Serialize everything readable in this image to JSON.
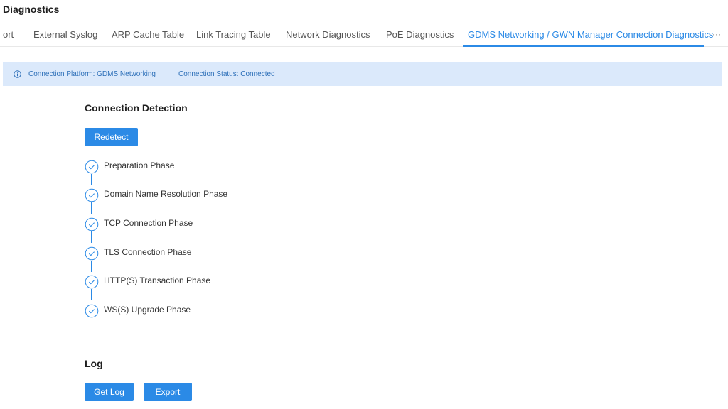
{
  "page": {
    "title": "Diagnostics"
  },
  "tabs": [
    {
      "label": "ort"
    },
    {
      "label": "External Syslog"
    },
    {
      "label": "ARP Cache Table"
    },
    {
      "label": "Link Tracing Table"
    },
    {
      "label": "Network Diagnostics"
    },
    {
      "label": "PoE Diagnostics"
    },
    {
      "label": "GDMS Networking / GWN Manager Connection Diagnostics"
    }
  ],
  "tabs_more": "···",
  "info": {
    "icon": "info-circle-icon",
    "platform": "Connection Platform: GDMS Networking",
    "status": "Connection Status: Connected"
  },
  "detection": {
    "title": "Connection Detection",
    "redetect_label": "Redetect",
    "phases": [
      {
        "label": "Preparation Phase",
        "status": "done"
      },
      {
        "label": "Domain Name Resolution Phase",
        "status": "done"
      },
      {
        "label": "TCP Connection Phase",
        "status": "done"
      },
      {
        "label": "TLS Connection Phase",
        "status": "done"
      },
      {
        "label": "HTTP(S) Transaction Phase",
        "status": "done"
      },
      {
        "label": "WS(S) Upgrade Phase",
        "status": "done"
      }
    ]
  },
  "log": {
    "title": "Log",
    "get_log_label": "Get Log",
    "export_label": "Export"
  },
  "colors": {
    "accent": "#2b8ae6",
    "info_bg": "#dbe9fb"
  }
}
